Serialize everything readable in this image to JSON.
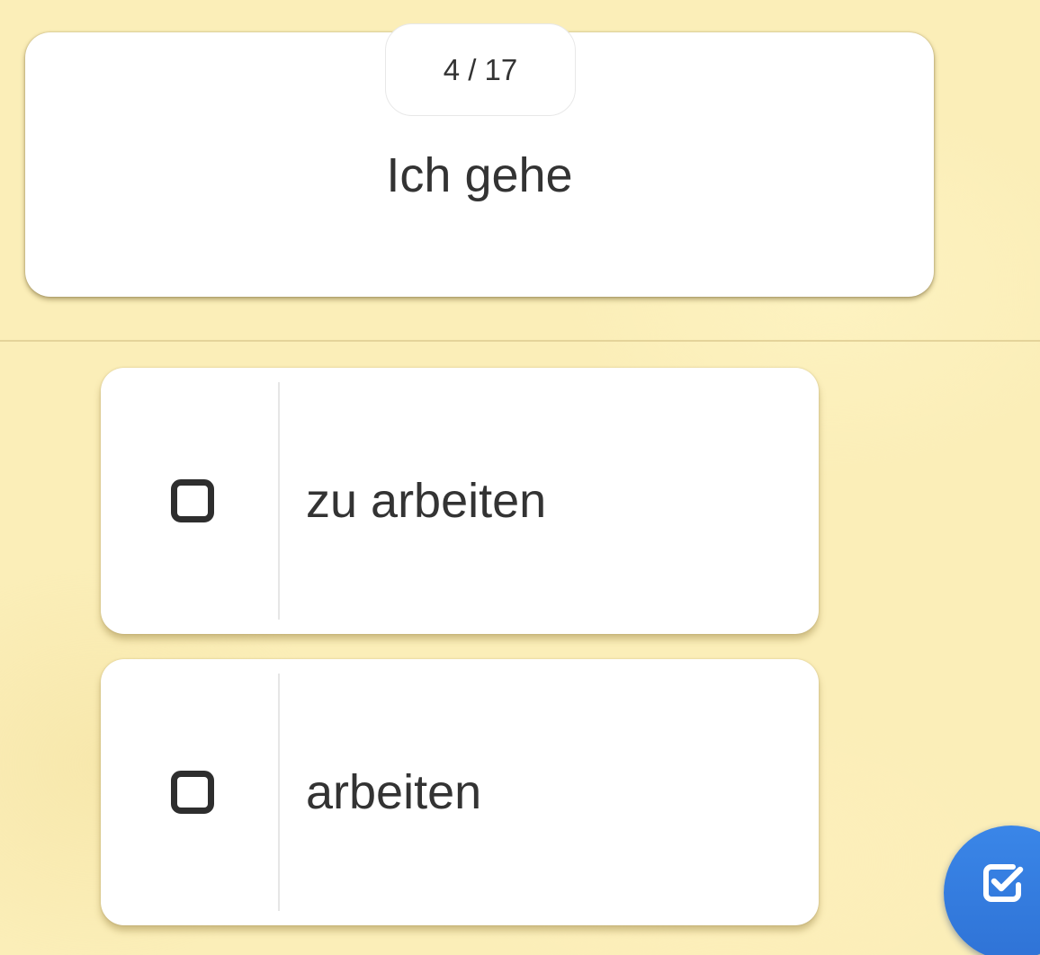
{
  "question": {
    "counter": "4 / 17",
    "text": "Ich gehe"
  },
  "answers": [
    {
      "label": "zu arbeiten",
      "checked": false
    },
    {
      "label": "arbeiten",
      "checked": false
    }
  ],
  "fab": {
    "icon": "check-square-icon"
  },
  "colors": {
    "background": "#fbeeb8",
    "card": "#ffffff",
    "text": "#333333",
    "fab": "#2f73d6"
  }
}
